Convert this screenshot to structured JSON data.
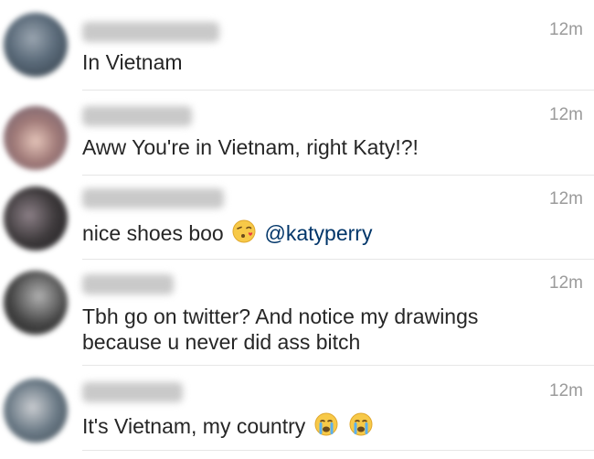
{
  "comments": [
    {
      "time": "12m",
      "text": "In Vietnam",
      "colors": {
        "avatar": "#5b6b7a",
        "username": "#c4c4c4"
      }
    },
    {
      "time": "12m",
      "text": "Aww You're in Vietnam, right Katy!?!",
      "colors": {
        "avatar": "#a07a78",
        "username": "#c4c4c4"
      }
    },
    {
      "time": "12m",
      "text": "nice shoes boo",
      "emoji": "kissing-heart-emoji",
      "mention": "@katyperry",
      "colors": {
        "avatar": "#3e3a3c",
        "username": "#c4c4c4",
        "mention": "#003569"
      }
    },
    {
      "time": "12m",
      "text_line1": "Tbh go on twitter? And notice my drawings",
      "text_line2": "because u never did ass bitch",
      "colors": {
        "avatar": "#444444",
        "username": "#c4c4c4"
      }
    },
    {
      "time": "12m",
      "text": "It's Vietnam, my country",
      "emojis": [
        "loudly-crying-emoji",
        "loudly-crying-emoji"
      ],
      "colors": {
        "avatar": "#6b7a86",
        "username": "#c4c4c4"
      }
    }
  ]
}
